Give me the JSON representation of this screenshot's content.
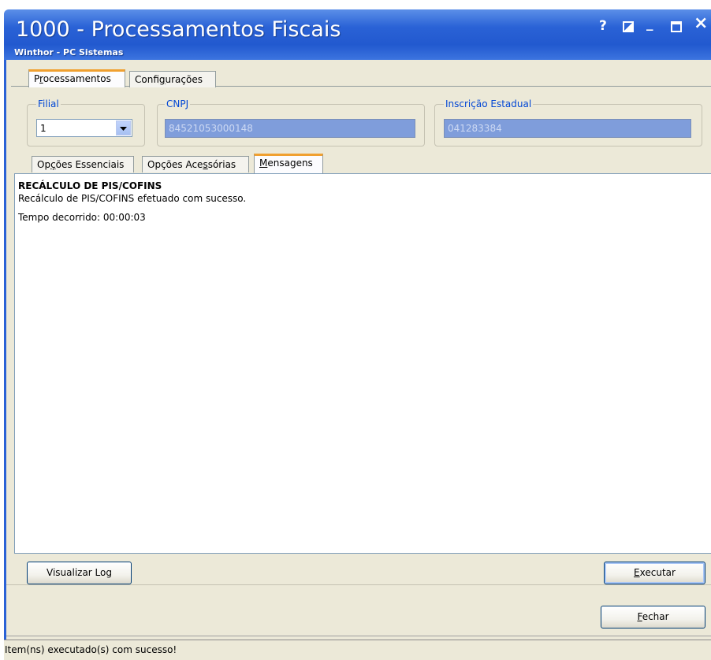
{
  "window": {
    "title": "1000 - Processamentos Fiscais",
    "subtitle": "Winthor - PC Sistemas",
    "controls": {
      "help": "?",
      "minimize": "_",
      "close": "×"
    }
  },
  "main_tabs": [
    {
      "prefix": "P",
      "underline": "r",
      "rest": "ocessamentos",
      "active": true
    },
    {
      "prefix": "Confi",
      "underline": "g",
      "rest": "urações",
      "active": false
    }
  ],
  "fields": {
    "filial": {
      "label": "Filial",
      "value": "1"
    },
    "cnpj": {
      "label": "CNPJ",
      "value": "84521053000148"
    },
    "inscricao": {
      "label": "Inscrição Estadual",
      "value": "041283384"
    }
  },
  "sub_tabs": [
    {
      "prefix": "Op",
      "underline": "ç",
      "rest": "ões Essenciais",
      "active": false
    },
    {
      "prefix": "Opções Ace",
      "underline": "s",
      "rest": "sórias",
      "active": false
    },
    {
      "prefix": "",
      "underline": "M",
      "rest": "ensagens",
      "active": true
    }
  ],
  "messages": {
    "heading": "RECÁLCULO DE PIS/COFINS",
    "line1": "Recálculo de PIS/COFINS efetuado com sucesso.",
    "line2": "Tempo decorrido: 00:00:03"
  },
  "buttons": {
    "visualizar_log": "Visualizar Log",
    "executar": {
      "underline": "E",
      "rest": "xecutar"
    },
    "fechar": {
      "underline": "F",
      "rest": "echar"
    }
  },
  "status": {
    "text": "Item(ns) executado(s) com sucesso!"
  },
  "colors": {
    "titlebar": "#2a62d6",
    "accent_tab": "#f0a030",
    "field_readonly": "#7f9ddb",
    "frame": "#ece9d8"
  }
}
